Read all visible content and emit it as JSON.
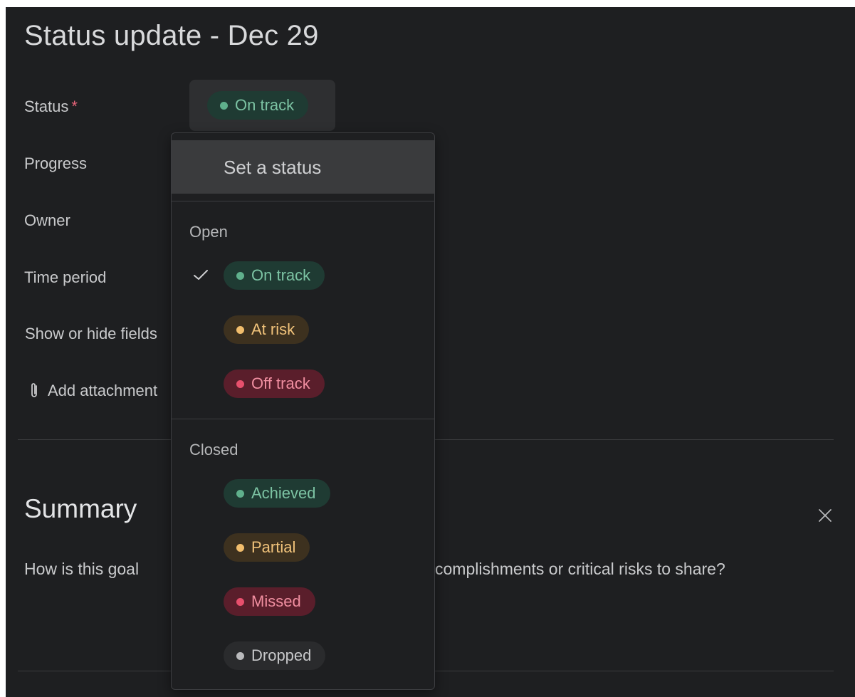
{
  "title": "Status update - Dec 29",
  "fields": {
    "status_label": "Status",
    "status_required": "*",
    "status_value": "On track",
    "progress_label": "Progress",
    "owner_label": "Owner",
    "time_period_label": "Time period",
    "show_hide_label": "Show or hide fields",
    "attachment_label": "Add attachment",
    "attachment_icon": "paperclip-icon"
  },
  "summary": {
    "title": "Summary",
    "prompt_left": "How is this goal",
    "prompt_right": "complishments or critical risks to share?",
    "close_icon": "close-icon"
  },
  "dropdown": {
    "header": "Set a status",
    "groups": [
      {
        "label": "Open",
        "options": [
          {
            "label": "On track",
            "color": "#5fb08c",
            "selected": true
          },
          {
            "label": "At risk",
            "color": "#f1bd6c"
          },
          {
            "label": "Off track",
            "color": "#e8506d"
          }
        ]
      },
      {
        "label": "Closed",
        "options": [
          {
            "label": "Achieved",
            "color": "#5fb08c"
          },
          {
            "label": "Partial",
            "color": "#f1bd6c"
          },
          {
            "label": "Missed",
            "color": "#e8506d"
          },
          {
            "label": "Dropped",
            "color": "#b9babc"
          }
        ]
      }
    ],
    "check_icon": "check-icon"
  },
  "colors": {
    "background": "#1e1f21",
    "green": "#5fb08c",
    "yellow": "#f1bd6c",
    "red": "#e8506d",
    "gray": "#b9babc"
  }
}
